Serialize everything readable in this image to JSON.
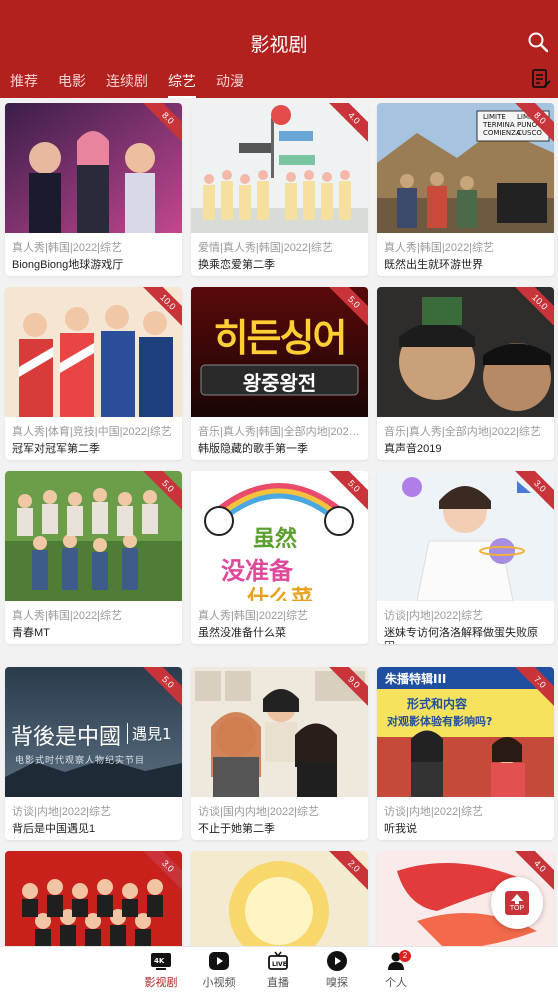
{
  "header": {
    "title": "影视剧",
    "tabs": [
      "推荐",
      "电影",
      "连续剧",
      "综艺",
      "动漫"
    ],
    "active_tab": "综艺"
  },
  "colors": {
    "brand": "#b3211f",
    "ribbon": "#c9333a"
  },
  "icons": {
    "search": "search-icon",
    "history": "history-list-icon",
    "scroll_top": "scroll-top-icon"
  },
  "cards": [
    {
      "meta": "真人秀|韩国|2022|综艺",
      "title": "BiongBiong地球游戏厅",
      "score": "8.0"
    },
    {
      "meta": "爱情|真人秀|韩国|2022|综艺",
      "title": "换乘恋爱第二季",
      "score": "4.0"
    },
    {
      "meta": "真人秀|韩国|2022|综艺",
      "title": "既然出生就环游世界",
      "score": "8.0"
    },
    {
      "meta": "真人秀|体育|竞技|中国|2022|综艺",
      "title": "冠军对冠军第二季",
      "score": "10.0"
    },
    {
      "meta": "音乐|真人秀|韩国|全部内地|2022|综艺",
      "title": "韩版隐藏的歌手第一季",
      "score": "5.0"
    },
    {
      "meta": "音乐|真人秀|全部内地|2022|综艺",
      "title": "真声音2019",
      "score": "10.0"
    },
    {
      "meta": "真人秀|韩国|2022|综艺",
      "title": "青春MT",
      "score": "5.0"
    },
    {
      "meta": "真人秀|韩国|2022|综艺",
      "title": "虽然没准备什么菜",
      "score": "5.0"
    },
    {
      "meta": "访谈|内地|2022|综艺",
      "title": "迷妹专访何洛洛解释做蛋失败原因",
      "score": "3.0"
    },
    {
      "meta": "访谈|内地|2022|综艺",
      "title": "背后是中国遇见1",
      "score": "5.0"
    },
    {
      "meta": "访谈|国内内地|2022|综艺",
      "title": "不止于她第二季",
      "score": "9.0"
    },
    {
      "meta": "访谈|内地|2022|综艺",
      "title": "听我说",
      "score": "7.0"
    },
    {
      "meta": "",
      "title": "",
      "score": "3.0"
    },
    {
      "meta": "",
      "title": "",
      "score": "2.0"
    },
    {
      "meta": "",
      "title": "",
      "score": "4.0"
    }
  ],
  "thumb_text": {
    "c3": [
      "LIMITE",
      "TERMINA",
      "COMIENZA",
      "LIMITE",
      "PUNO",
      "CUSCO"
    ],
    "c5a": "히든싱어",
    "c5b": "왕중왕전",
    "c8a": "虽然",
    "c8b": "没准备",
    "c8c": "什么菜",
    "c10a": "背後是中國",
    "c10b": "遇見1",
    "c10c": "电影式时代观察人物纪实节目",
    "c12a": "朱播特辑III",
    "c12b": "形式和内容",
    "c12c": "对观影体验有影响吗?"
  },
  "scroll_top_label": "TOP",
  "bottom_nav": [
    {
      "label": "影视剧",
      "icon": "4k-tv-icon",
      "active": true
    },
    {
      "label": "小视频",
      "icon": "play-circle-icon",
      "active": false
    },
    {
      "label": "直播",
      "icon": "live-tv-icon",
      "active": false
    },
    {
      "label": "嗅探",
      "icon": "play-circle-icon",
      "active": false
    },
    {
      "label": "个人",
      "icon": "person-icon",
      "active": false,
      "badge": "2"
    }
  ]
}
